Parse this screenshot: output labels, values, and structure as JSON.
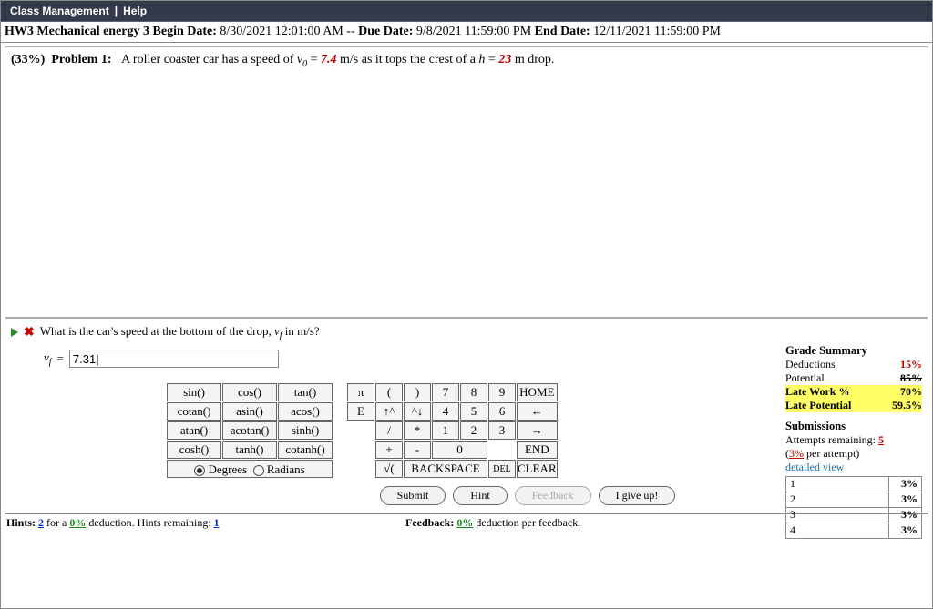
{
  "topbar": {
    "classmgmt": "Class Management",
    "help": "Help",
    "sep": "|"
  },
  "header": {
    "assign": "HW3 Mechanical energy 3",
    "begin_lbl": "Begin Date:",
    "begin": "8/30/2021 12:01:00 AM",
    "sep": "--",
    "due_lbl": "Due Date:",
    "due": "9/8/2021 11:59:00 PM",
    "end_lbl": "End Date:",
    "end": "12/11/2021 11:59:00 PM"
  },
  "problem": {
    "pct": "(33%)",
    "label": "Problem 1:",
    "t1": "A roller coaster car has a speed of ",
    "v0": "v",
    "v0sub": "0",
    "eq": " = ",
    "v0val": "7.4",
    "t2": " m/s as it tops the crest of a ",
    "hvar": "h",
    "heq": " = ",
    "hval": "23",
    "t3": " m drop."
  },
  "question": {
    "text1": "What is the car's speed at the bottom of the drop, ",
    "vf": "v",
    "vfsub": "f",
    "text2": " in m/s?",
    "anslabel_v": "v",
    "anslabel_sub": "f",
    "anslabel_eq": " = ",
    "ansval": "7.31|"
  },
  "fnkeys": {
    "r1": [
      "sin()",
      "cos()",
      "tan()"
    ],
    "r2": [
      "cotan()",
      "asin()",
      "acos()"
    ],
    "r3": [
      "atan()",
      "acotan()",
      "sinh()"
    ],
    "r4": [
      "cosh()",
      "tanh()",
      "cotanh()"
    ],
    "deg": "Degrees",
    "rad": "Radians"
  },
  "numkeys": {
    "r1": [
      "π",
      "(",
      ")",
      "7",
      "8",
      "9",
      "HOME"
    ],
    "r2": [
      "E",
      "↑^",
      "^↓",
      "4",
      "5",
      "6",
      "←"
    ],
    "r3": [
      "",
      "/",
      "*",
      "1",
      "2",
      "3",
      "→"
    ],
    "r4": [
      "",
      "+",
      "-",
      "0",
      "",
      "END"
    ],
    "r5": [
      "",
      "√(",
      "BACKSPACE",
      "DEL",
      "CLEAR"
    ]
  },
  "buttons": {
    "submit": "Submit",
    "hint": "Hint",
    "feedback": "Feedback",
    "giveup": "I give up!"
  },
  "grade": {
    "title": "Grade Summary",
    "ded_l": "Deductions",
    "ded_v": "15%",
    "pot_l": "Potential",
    "pot_v": "85%",
    "lw_l": "Late Work %",
    "lw_v": "70%",
    "lp_l": "Late Potential",
    "lp_v": "59.5%"
  },
  "subs": {
    "title": "Submissions",
    "rem_l": "Attempts remaining: ",
    "rem_v": "5",
    "per": "(",
    "per_v": "3%",
    "per2": " per attempt)",
    "dv": "detailed view",
    "rows": [
      {
        "n": "1",
        "p": "3%"
      },
      {
        "n": "2",
        "p": "3%"
      },
      {
        "n": "3",
        "p": "3%"
      },
      {
        "n": "4",
        "p": "3%"
      }
    ]
  },
  "bottom": {
    "hints_l": "Hints:",
    "hints_n": "2",
    "hints_t": " for a ",
    "hints_p": "0%",
    "hints_t2": " deduction. Hints remaining: ",
    "hints_r": "1",
    "fb_l": "Feedback:",
    "fb_p": "0%",
    "fb_t": " deduction per feedback."
  }
}
